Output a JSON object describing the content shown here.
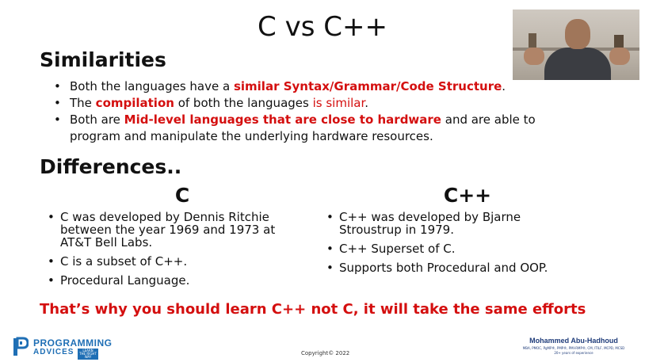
{
  "title": "C vs C++",
  "similarities": {
    "heading": "Similarities",
    "items": [
      {
        "pre": "Both the languages have a ",
        "hl": "similar Syntax/Grammar/Code Structure",
        "post": "."
      },
      {
        "pre": "The ",
        "hl": "compilation",
        "mid": " of both the languages ",
        "red": "is similar",
        "post": "."
      },
      {
        "pre": "Both are ",
        "hl": "Mid-level languages that are close to hardware",
        "post": " and are able to program and manipulate the underlying hardware resources."
      }
    ]
  },
  "differences": {
    "heading": "Differences..",
    "c": {
      "title": "C",
      "items": [
        "C was developed by Dennis Ritchie between the year 1969 and 1973 at AT&T Bell Labs.",
        "C is a subset of C++.",
        "Procedural Language."
      ]
    },
    "cpp": {
      "title": "C++",
      "items": [
        "C++ was developed by Bjarne Stroustrup in 1979.",
        "C++ Superset of C.",
        "Supports both Procedural and OOP."
      ]
    }
  },
  "conclusion": "That’s why you should learn C++ not C, it will take the same efforts",
  "footer": {
    "copyright": "Copyright© 2022",
    "logo_line1": "PROGRAMMING",
    "logo_line2": "ADVICES",
    "logo_tagline": "LEARN THE RIGHT WAY",
    "author_name": "Mohammed Abu-Hadhoud",
    "author_creds": "MBA, PMOC, PgMP®, PMP®, PMI-RMP®, CM, ITILF, MCPD, MCSD",
    "author_experience": "20+ years of experience"
  },
  "colors": {
    "highlight": "#d40f0f",
    "brand": "#1f6fb5"
  }
}
